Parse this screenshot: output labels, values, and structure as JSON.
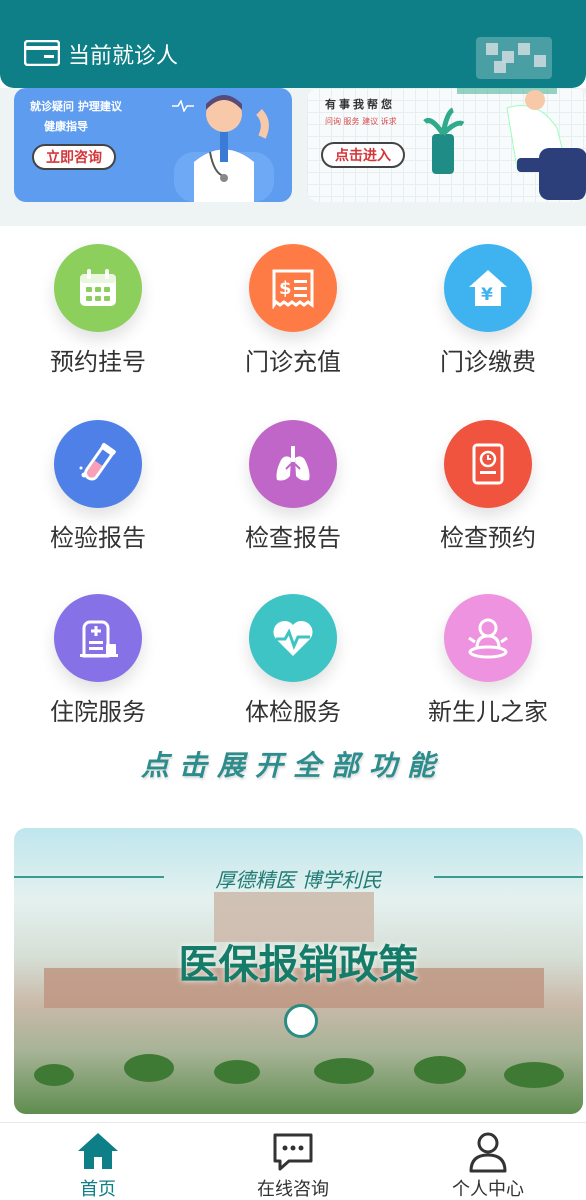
{
  "header": {
    "title": "当前就诊人"
  },
  "banners": {
    "left": {
      "line1": "就诊疑问  护理建议",
      "line2": "健康指导",
      "cta": "立即咨询"
    },
    "right": {
      "line1": "有事我帮您",
      "line2": "问询  服务  建议  诉求",
      "cta": "点击进入"
    }
  },
  "services": [
    {
      "label": "预约挂号",
      "icon": "calendar-icon",
      "color": "#8ccf5c"
    },
    {
      "label": "门诊充值",
      "icon": "receipt-icon",
      "color": "#ff7b45"
    },
    {
      "label": "门诊缴费",
      "icon": "yuan-house-icon",
      "color": "#3fb2f0"
    },
    {
      "label": "检验报告",
      "icon": "test-tube-icon",
      "color": "#4e80e8"
    },
    {
      "label": "检查报告",
      "icon": "lungs-icon",
      "color": "#c066c8"
    },
    {
      "label": "检查预约",
      "icon": "clock-document-icon",
      "color": "#f0533e"
    },
    {
      "label": "住院服务",
      "icon": "hospital-bed-icon",
      "color": "#8672e6"
    },
    {
      "label": "体检服务",
      "icon": "heartbeat-icon",
      "color": "#3ec4c4"
    },
    {
      "label": "新生儿之家",
      "icon": "baby-icon",
      "color": "#ee93df"
    }
  ],
  "expand_all": "点击展开全部功能",
  "policy_banner": {
    "slogan": "厚德精医  博学利民",
    "title": "医保报销政策"
  },
  "bottom_nav": [
    {
      "label": "首页",
      "icon": "home-icon",
      "active": true
    },
    {
      "label": "在线咨询",
      "icon": "chat-bubble-icon",
      "active": false
    },
    {
      "label": "个人中心",
      "icon": "user-icon",
      "active": false
    }
  ],
  "colors": {
    "brand": "#0e7f86",
    "accent_text": "#2d8d8d"
  }
}
